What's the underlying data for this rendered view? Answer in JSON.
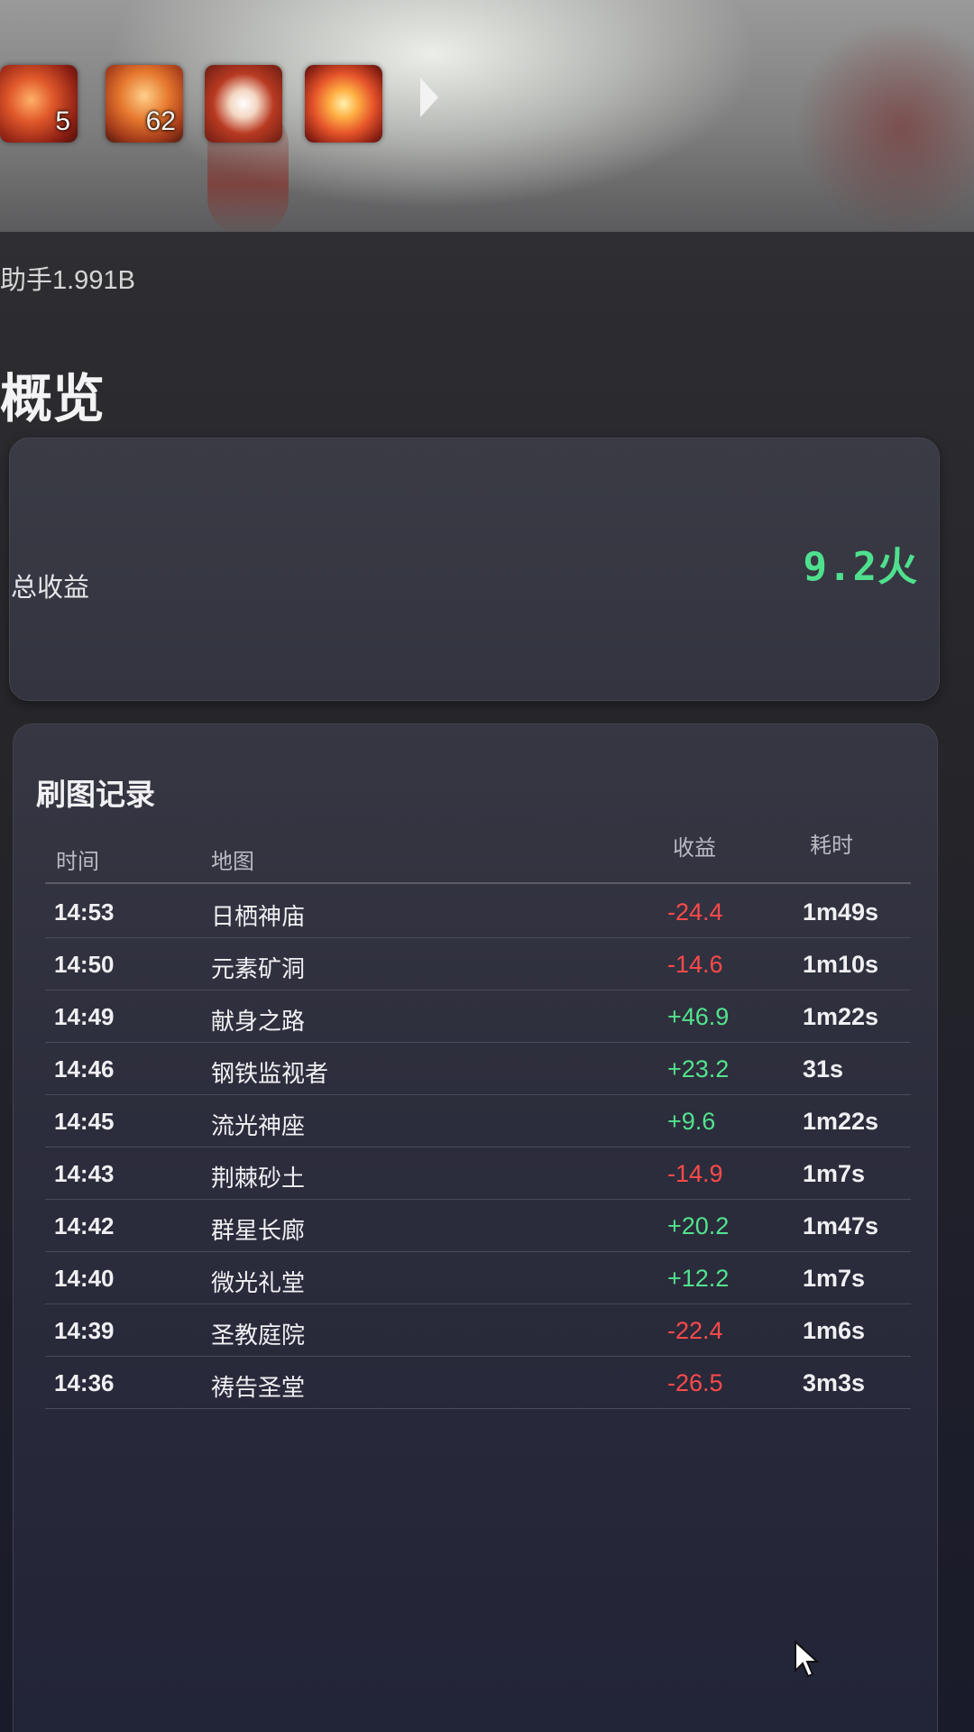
{
  "banner": {
    "skills": [
      {
        "name": "skill-icon-1",
        "count": "5"
      },
      {
        "name": "skill-icon-2",
        "count": "62"
      },
      {
        "name": "skill-icon-3",
        "count": ""
      },
      {
        "name": "skill-icon-4",
        "count": ""
      }
    ],
    "next_icon": "chevron-right-icon"
  },
  "version_text": "助手1.991B",
  "page_title": "概览",
  "summary": {
    "total_label": "总收益",
    "total_value": "9.2火"
  },
  "records": {
    "title": "刷图记录",
    "columns": [
      "时间",
      "地图",
      "收益",
      "耗时"
    ],
    "rows": [
      {
        "time": "14:53",
        "map": "日栖神庙",
        "profit": "-24.4",
        "duration": "1m49s"
      },
      {
        "time": "14:50",
        "map": "元素矿洞",
        "profit": "-14.6",
        "duration": "1m10s"
      },
      {
        "time": "14:49",
        "map": "献身之路",
        "profit": "+46.9",
        "duration": "1m22s"
      },
      {
        "time": "14:46",
        "map": "钢铁监视者",
        "profit": "+23.2",
        "duration": "31s"
      },
      {
        "time": "14:45",
        "map": "流光神座",
        "profit": "+9.6",
        "duration": "1m22s"
      },
      {
        "time": "14:43",
        "map": "荆棘砂土",
        "profit": "-14.9",
        "duration": "1m7s"
      },
      {
        "time": "14:42",
        "map": "群星长廊",
        "profit": "+20.2",
        "duration": "1m47s"
      },
      {
        "time": "14:40",
        "map": "微光礼堂",
        "profit": "+12.2",
        "duration": "1m7s"
      },
      {
        "time": "14:39",
        "map": "圣教庭院",
        "profit": "-22.4",
        "duration": "1m6s"
      },
      {
        "time": "14:36",
        "map": "祷告圣堂",
        "profit": "-26.5",
        "duration": "3m3s"
      }
    ]
  },
  "colors": {
    "positive": "#52e38d",
    "negative": "#ff4a4a",
    "total": "#4fe08e"
  }
}
